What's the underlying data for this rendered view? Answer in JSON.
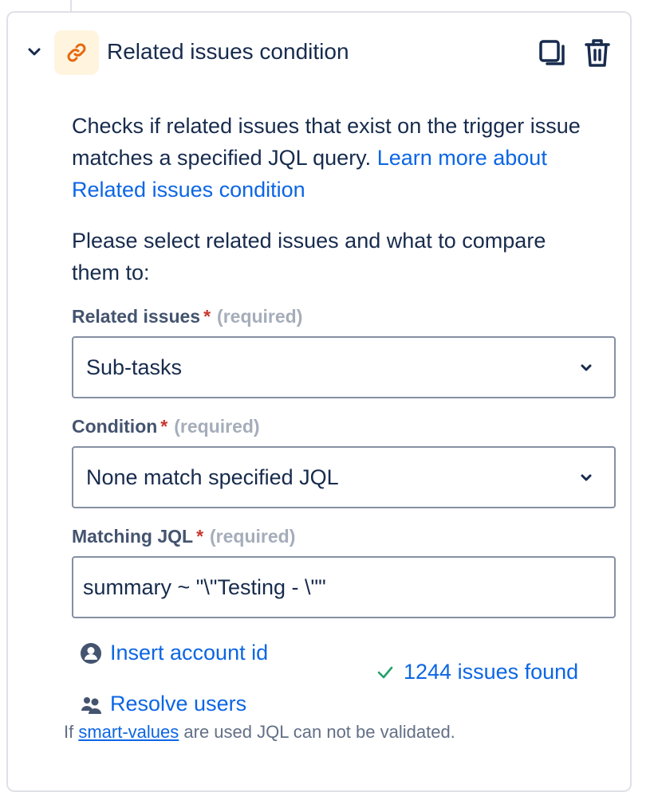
{
  "condition": {
    "title": "Related issues condition",
    "accent_color": "#e56910",
    "icon_bg": "#fff4de",
    "description_text": "Checks if related issues that exist on the trigger issue matches a specified JQL query. ",
    "learn_more_label": "Learn more about Related issues condition",
    "prompt": "Please select related issues and what to compare them to:"
  },
  "fields": {
    "related_issues": {
      "label": "Related issues",
      "star": "*",
      "required": "(required)",
      "value": "Sub-tasks"
    },
    "condition": {
      "label": "Condition",
      "star": "*",
      "required": "(required)",
      "value": "None match specified JQL"
    },
    "matching_jql": {
      "label": "Matching JQL",
      "star": "*",
      "required": "(required)",
      "value": "summary ~ \"\\\"Testing - \\\"\""
    }
  },
  "actions": {
    "insert_account_id": "Insert account id",
    "resolve_users": "Resolve users",
    "issues_found": "1244 issues found"
  },
  "footnote": {
    "prefix": "If ",
    "link": "smart-values",
    "suffix": " are used JQL can not be validated."
  },
  "icons": {
    "collapse": "chevron-down-icon",
    "condition": "link-icon",
    "copy": "copy-icon",
    "delete": "trash-icon",
    "account": "user-circle-icon",
    "users": "people-icon",
    "check": "check-icon"
  },
  "colors": {
    "link": "#0c66e4",
    "success": "#22a06b",
    "required_star": "#c9372c"
  }
}
